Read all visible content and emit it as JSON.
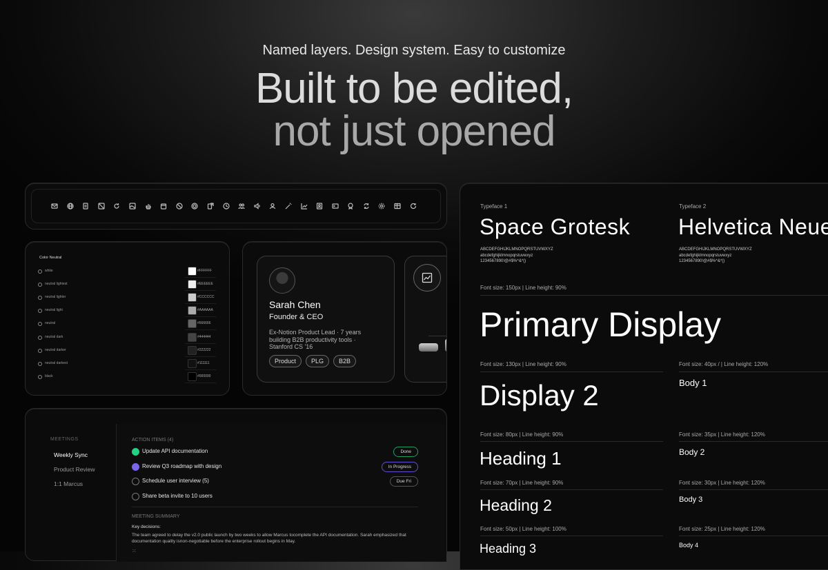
{
  "hero": {
    "subtitle": "Named layers. Design system. Easy to customize",
    "title_line1": "Built to be edited,",
    "title_line2": "not just opened"
  },
  "icons": [
    "mail-icon",
    "globe-icon",
    "document-icon",
    "image-off-icon",
    "refresh-icon",
    "image-icon",
    "hand-icon",
    "calendar-icon",
    "ban-icon",
    "target-icon",
    "share-icon",
    "clock-icon",
    "users-icon",
    "volume-icon",
    "user-icon",
    "magic-wand-icon",
    "chart-icon",
    "id-card-icon",
    "terminal-icon",
    "badge-icon",
    "sync-icon",
    "settings-icon",
    "table-icon",
    "rotate-icon"
  ],
  "colors": {
    "title": "Color Neutral",
    "items": [
      {
        "name": "white",
        "hex": "#FFFFFF",
        "color": "#FFFFFF"
      },
      {
        "name": "neutral lightest",
        "hex": "#EEEEEE",
        "color": "#EEEEEE"
      },
      {
        "name": "neutral lighter",
        "hex": "#CCCCCC",
        "color": "#CCCCCC"
      },
      {
        "name": "neutral light",
        "hex": "#AAAAAA",
        "color": "#AAAAAA"
      },
      {
        "name": "neutral",
        "hex": "#666666",
        "color": "#666666"
      },
      {
        "name": "neutral dark",
        "hex": "#444444",
        "color": "#444444"
      },
      {
        "name": "neutral darker",
        "hex": "#222222",
        "color": "#222222"
      },
      {
        "name": "neutral darkest",
        "hex": "#111111",
        "color": "#111111"
      },
      {
        "name": "black",
        "hex": "#000000",
        "color": "#000000"
      }
    ]
  },
  "profile": {
    "name": "Sarah Chen",
    "role": "Founder & CEO",
    "bio": "Ex-Notion Product Lead · 7 years building B2B productivity tools · Stanford CS '16",
    "tags": [
      "Product",
      "PLG",
      "B2B"
    ]
  },
  "meetings": {
    "label": "MEETINGS",
    "items": [
      "Weekly Sync",
      "Product Review",
      "1:1 Marcus"
    ],
    "action_label": "ACTION ITEMS (4)",
    "actions": [
      {
        "text": "Update API documentation",
        "badge": "Done",
        "state": "done"
      },
      {
        "text": "Review Q3 roadmap with design",
        "badge": "In Progress",
        "state": "progress"
      },
      {
        "text": "Schedule user interview (5)",
        "badge": "Due Fri",
        "state": "due"
      },
      {
        "text": "Share beta invite to 10 users",
        "badge": "",
        "state": "none"
      }
    ],
    "summary_label": "MEETING SUMMARY",
    "key_decisions": "Key decisions:",
    "summary_text": "The team agreed to delay the v2.0 public launch by two weeks to allow Marcus tocomplete the API documentation. Sarah emphasized that documentation quality isnon-negotiable before the enterprise rollout begins in May."
  },
  "typography": {
    "typeface1_label": "Typeface 1",
    "typeface1_name": "Space Grotesk",
    "typeface1_upper": "ABCDEFGHIJKLMNOPQRSTUVWXYZ",
    "typeface1_lower": "abcdefghijklmnopqrstuvwxyz",
    "typeface1_nums": "1234567890!@#$%^&*()",
    "typeface2_label": "Typeface 2",
    "typeface2_name": "Helvetica Neue",
    "typeface2_upper": "ABCDEFGHIJKLMNOPQRSTUVWXYZ",
    "typeface2_lower": "abcdefghijklmnopqrstuvwxyz",
    "typeface2_nums": "1234567890!@#$%^&*()",
    "primary_meta": "Font size: 150px | Line height: 90%",
    "primary_sample": "Primary Display",
    "display2_meta": "Font size: 130px | Line height: 90%",
    "display2_sample": "Display 2",
    "h1_meta": "Font size: 80px | Line height: 90%",
    "h1_sample": "Heading 1",
    "h2_meta": "Font size: 70px | Line height: 90%",
    "h2_sample": "Heading 2",
    "h3_meta": "Font size: 50px | Line height: 100%",
    "h3_sample": "Heading 3",
    "body1_meta": "Font size: 40px / | Line height: 120%",
    "body1_sample": "Body 1",
    "body2_meta": "Font size: 35px | Line height: 120%",
    "body2_sample": "Body 2",
    "body3_meta": "Font size: 30px | Line height: 120%",
    "body3_sample": "Body 3",
    "body4_meta": "Font size: 25px | Line height: 120%",
    "body4_sample": "Body 4"
  }
}
